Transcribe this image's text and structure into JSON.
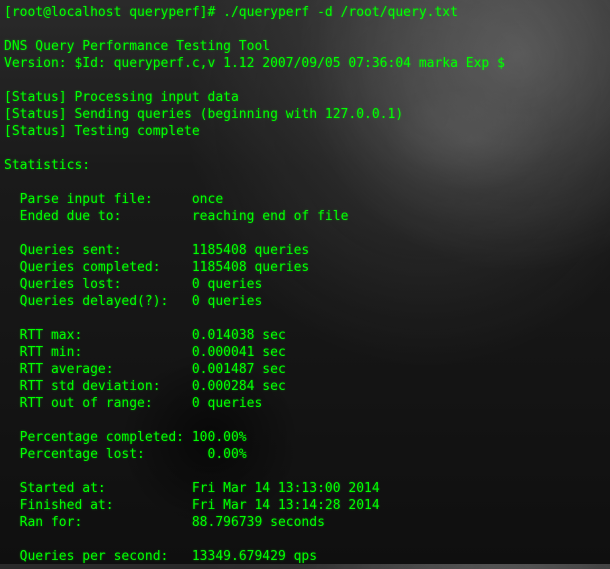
{
  "prompt": {
    "user_host": "[root@localhost queryperf]# ",
    "command": "./queryperf -d /root/query.txt"
  },
  "header": {
    "title": "DNS Query Performance Testing Tool",
    "version": "Version: $Id: queryperf.c,v 1.12 2007/09/05 07:36:04 marka Exp $"
  },
  "status": {
    "line1": "[Status] Processing input data",
    "line2": "[Status] Sending queries (beginning with 127.0.0.1)",
    "line3": "[Status] Testing complete"
  },
  "stats_header": "Statistics:",
  "stats": {
    "parse_label": "  Parse input file:",
    "parse_value": "once",
    "ended_label": "  Ended due to:",
    "ended_value": "reaching end of file",
    "sent_label": "  Queries sent:",
    "sent_value": "1185408 queries",
    "completed_label": "  Queries completed:",
    "completed_value": "1185408 queries",
    "lost_label": "  Queries lost:",
    "lost_value": "0 queries",
    "delayed_label": "  Queries delayed(?):",
    "delayed_value": "0 queries",
    "rtt_max_label": "  RTT max:",
    "rtt_max_value": "0.014038 sec",
    "rtt_min_label": "  RTT min:",
    "rtt_min_value": "0.000041 sec",
    "rtt_avg_label": "  RTT average:",
    "rtt_avg_value": "0.001487 sec",
    "rtt_std_label": "  RTT std deviation:",
    "rtt_std_value": "0.000284 sec",
    "rtt_oor_label": "  RTT out of range:",
    "rtt_oor_value": "0 queries",
    "pct_comp_label": "  Percentage completed:",
    "pct_comp_value": "100.00%",
    "pct_lost_label": "  Percentage lost:",
    "pct_lost_value": "  0.00%",
    "started_label": "  Started at:",
    "started_value": "Fri Mar 14 13:13:00 2014",
    "finished_label": "  Finished at:",
    "finished_value": "Fri Mar 14 13:14:28 2014",
    "ran_label": "  Ran for:",
    "ran_value": "88.796739 seconds",
    "qps_label": "  Queries per second:",
    "qps_value": "13349.679429 qps"
  }
}
